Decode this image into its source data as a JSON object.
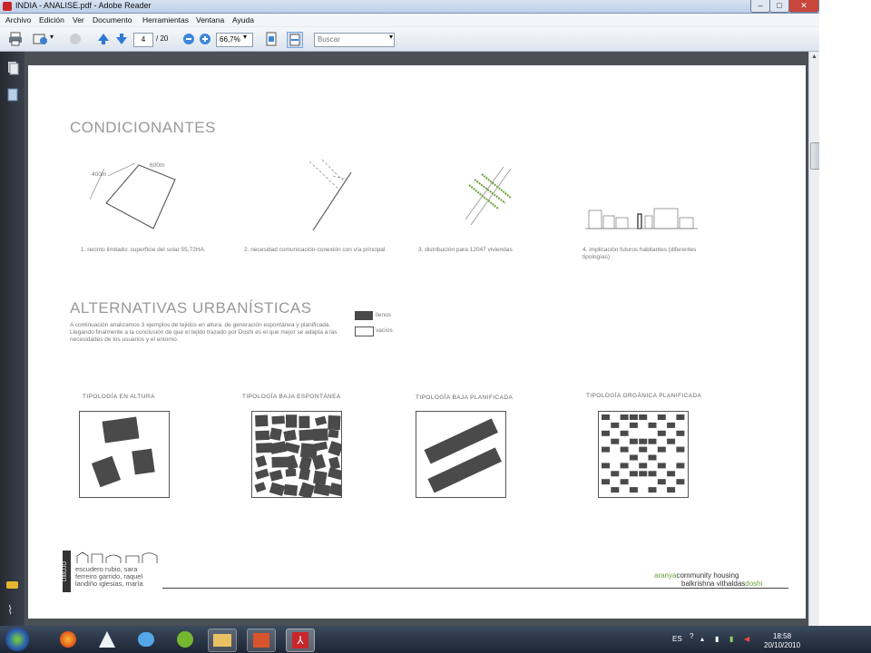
{
  "window": {
    "title": "INDIA - ANALISE.pdf - Adobe Reader",
    "controls": [
      "–",
      "□",
      "✕"
    ]
  },
  "menu": [
    "Archivo",
    "Edición",
    "Ver",
    "Documento",
    "Herramientas",
    "Ventana",
    "Ayuda"
  ],
  "toolbar": {
    "page_current": "4",
    "page_total": "/ 20",
    "zoom": "66,7%",
    "search_placeholder": "Buscar"
  },
  "pdf": {
    "heading1": "CONDICIONANTES",
    "dim_400": "400m",
    "dim_600": "600m",
    "captions": [
      "1. recinto limitado: superficie del solar 55,72HA.",
      "2. necesidad comunicación-conexión con vía principal",
      "3. distribución para 12047 viviendas",
      "4. implicación futuros habitantes (diferentes tipologías)"
    ],
    "heading2": "ALTERNATIVAS URBANÍSTICAS",
    "legend_llenos": "llenos",
    "legend_vacios": "vacíos",
    "intro": "A continuación analizamos 3 ejemplos de tejidos en altura, de generación espontánea y planificada. Llegando finalmente a la conclusión de que el tejido trazado por Doshi es el que mejor se adapta a las necesidades de los usuarios y el entorno.",
    "typologies": [
      "TIPOLOGÍA EN ALTURA",
      "TIPOLOGÍA  BAJA ESPONTÁNEA",
      "TIPOLOGÍA  BAJA PLANIFICADA",
      "TIPOLOGÍA ORGÁNICA PLANIFICADA"
    ],
    "footer_vertical": "DIBUJO",
    "authors": [
      "escudero rubio, sara",
      "ferreiro garrido, raquel",
      "landiño iglesias, maría"
    ],
    "project_a1": "aranya",
    "project_a2": "community housing",
    "project_b1": "balkrishna vithaldas",
    "project_b2": "doshi"
  },
  "tray": {
    "lang": "ES",
    "time": "18:58",
    "date": "20/10/2010"
  },
  "colors": {
    "accent_pdf": "#c8262b",
    "fill": "#4a4a4a",
    "green": "#6aa23a"
  }
}
